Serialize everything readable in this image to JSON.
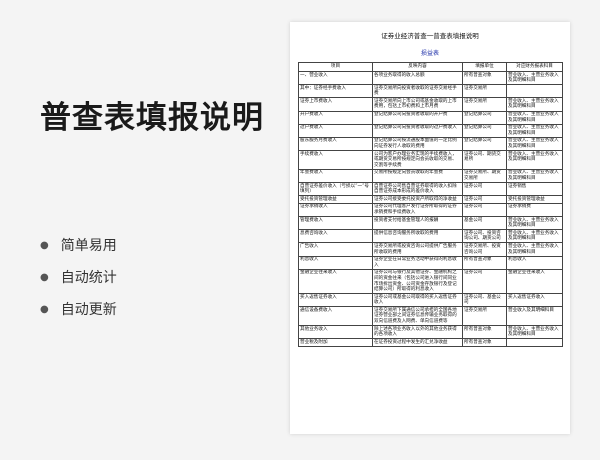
{
  "title": "普查表填报说明",
  "features": [
    "简单易用",
    "自动统计",
    "自动更新"
  ],
  "doc": {
    "title": "证券业经济普查一普查表填报说明",
    "subtitle": "损益表",
    "headers": [
      "项目",
      "反映内容",
      "填报单位",
      "对应财务报表科目"
    ],
    "rows": [
      [
        "一、营业收入",
        "各项业务取得的收入总额",
        "所有普查对象",
        "营业收入、主营业务收入及其明细科目"
      ],
      [
        "其中：证券经手费收入",
        "证券交易所向投资者收取的证券交易经手费",
        "证券交易所",
        ""
      ],
      [
        "证券上市费收入",
        "证券交易所向上市公司或基金收取的上市费用，包括上市初费和上市月费",
        "证券交易所",
        "营业收入、主营业务收入及其明细科目"
      ],
      [
        "开户费收入",
        "登记结算公司向投资者收取的开户费",
        "登记结算公司",
        "营业收入、主营业务收入及其明细科目"
      ],
      [
        "过户费收入",
        "登记结算公司向投资者收取的过户费收入",
        "登记结算公司",
        "营业收入、主营业务收入及其明细科目"
      ],
      [
        "股东服务月费收入",
        "登记结算公司按流通股本面值的一定比例向证券发行人收取的费用",
        "登记结算公司",
        "营业收入、主营业务收入及其明细科目"
      ],
      [
        "手续费收入",
        "公司为客户办理业务实现的手续费收入，或期货交易所按规定向会员收取的交易、交割等手续费",
        "证券公司、期货交易所",
        "营业收入、主营业务收入及其明细科目"
      ],
      [
        "年会费收入",
        "交易所按规定向会员收取的年会费",
        "证券交易所、期货交易所",
        "营业收入、主营业务收入及其明细科目"
      ],
      [
        "自营证券差价收入（亏损以“一”号填列）",
        "自营证券公司售自营证券取得的收入扣除自营证券成本形成的差价收入",
        "证券公司",
        "证券销售"
      ],
      [
        "受托投资管理收益",
        "证券公司接受委托投资产所取得的净收益",
        "证券公司",
        "受托投资管理收益"
      ],
      [
        "证券承销收入",
        "证券公司代理客户发行证券所取得的证券承销费和手续费收入",
        "证券公司",
        "证券承销费"
      ],
      [
        "管理费收入",
        "投资者支付给基金管理人的报酬",
        "基金公司",
        "营业收入、主营业务收入及其明细科目"
      ],
      [
        "息费咨询收入",
        "提供信息咨询服务所收取的费用",
        "证券公司、投资咨询公司、期货公司",
        "营业收入、主营业务收入及其明细科目"
      ],
      [
        "广告收入",
        "证券交易所或投资咨询公司提供广告服务所收取的费用",
        "证券交易所、投资咨询公司",
        "营业收入、主营业务收入及其明细科目"
      ],
      [
        "利息收入",
        "证券企业在日常业务活动中获得的利息收入",
        "所有普查对象",
        "利息收入"
      ],
      [
        "金融企业往来收入",
        "证券公司与银行及其他证券、金融机构之间的资金往来（包括公司进入银行间同业市场拆出资金、公司资金存放银行及登记结算公司）所取得的利息收入",
        "证券公司",
        "金融企业往来收入"
      ],
      [
        "买入返售证券收入",
        "证券公司或基金公司取得的买入返售证券收入",
        "证券公司、基金公司",
        "买入返售证券收入"
      ],
      [
        "通信设备费收入",
        "证券交易所下属通信公司承担的全国各地证券营业部之间证券信息传输业务取得的双向信道费及入网费、单向信道费等",
        "证券交易所",
        "营业收入及其明细科目"
      ],
      [
        "其他业务收入",
        "除上述各项业务收入以外的其他业务获得的各项收入",
        "所有普查对象",
        "营业收入、主营业务收入及其明细科目"
      ],
      [
        "营业税及附加",
        "在证券投资过程中发生的汇兑净收益",
        "所有普查对象",
        ""
      ]
    ]
  }
}
